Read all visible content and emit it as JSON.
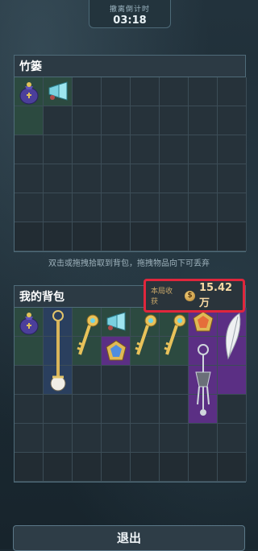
{
  "timer": {
    "label": "撤离倒计时",
    "value": "03:18"
  },
  "basket": {
    "title": "竹篓"
  },
  "hint": "双击或拖拽拾取到背包，拖拽物品向下可丢弃",
  "backpack": {
    "title": "我的背包",
    "earnings_label": "本局收获",
    "earnings_value": "15.42万",
    "coin_symbol": "$"
  },
  "exit_button": {
    "label": "退出"
  },
  "colors": {
    "highlight_border": "#e0263c",
    "rarity_green": "#2c4a40",
    "rarity_blue": "#2a3f5e",
    "rarity_purple": "#5b2f84"
  },
  "items": {
    "basket": [
      "money-bag-icon",
      "whistle-horn-icon"
    ],
    "backpack": [
      "money-bag-icon",
      "ornate-staff-icon",
      "golden-key-icon",
      "whistle-horn-icon",
      "blue-gem-crest-icon",
      "golden-key-icon",
      "golden-key-icon",
      "golden-key-icon",
      "orange-gem-crest-icon",
      "hanging-charm-icon",
      "white-feather-icon"
    ]
  }
}
